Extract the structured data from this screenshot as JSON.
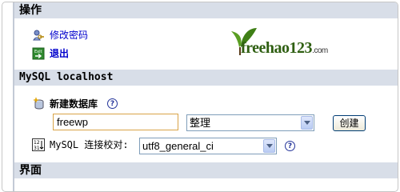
{
  "sections": {
    "operations_title": "操作",
    "server_title": "MySQL localhost",
    "interface_title": "界面"
  },
  "operations": {
    "change_password": "修改密码",
    "logout": "退出"
  },
  "logo": {
    "text": "freehao123",
    "suffix": ".com"
  },
  "create_db": {
    "label": "新建数据库",
    "help": "?",
    "name_value": "freewp",
    "collation_selected": "整理",
    "create_button": "创建"
  },
  "connection": {
    "label": "MySQL 连接校对:",
    "collation_selected": "utf8_general_ci",
    "help": "?"
  },
  "icons": {
    "change_password": "key-user-icon",
    "logout": "exit-icon",
    "new_database": "new-database-icon",
    "collation": "collation-icon"
  },
  "colors": {
    "header_bg": "#d8dee8",
    "link": "#0000cc",
    "logo_green": "#4a8d1f"
  }
}
